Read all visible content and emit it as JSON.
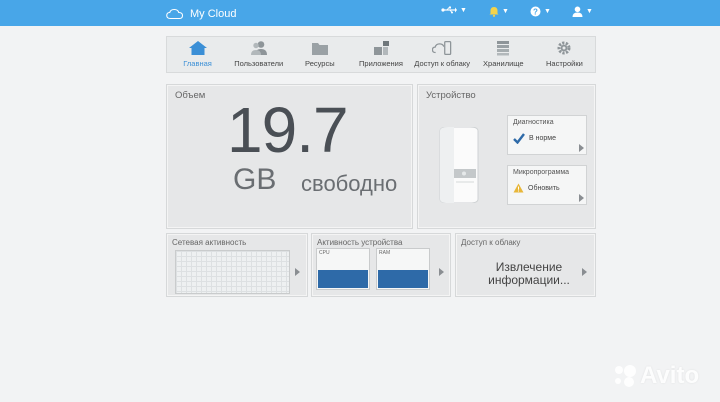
{
  "topbar": {
    "brand": "My Cloud",
    "icons": [
      "usb-icon",
      "bell-icon",
      "help-icon",
      "user-icon"
    ],
    "accent_color": "#48a6e8"
  },
  "nav": {
    "items": [
      {
        "label": "Главная",
        "icon": "home-icon",
        "active": true
      },
      {
        "label": "Пользователи",
        "icon": "users-icon"
      },
      {
        "label": "Ресурсы",
        "icon": "folder-icon"
      },
      {
        "label": "Приложения",
        "icon": "apps-icon"
      },
      {
        "label": "Доступ к облаку",
        "icon": "cloud-phone-icon"
      },
      {
        "label": "Хранилище",
        "icon": "storage-icon"
      },
      {
        "label": "Настройки",
        "icon": "gear-icon"
      }
    ]
  },
  "capacity": {
    "title": "Объем",
    "value": "19.7",
    "unit": "GB",
    "status": "свободно"
  },
  "device": {
    "title": "Устройство",
    "diagnostics": {
      "title": "Диагностика",
      "status": "В норме"
    },
    "firmware": {
      "title": "Микропрограмма",
      "status": "Обновить"
    }
  },
  "network": {
    "title": "Сетевая активность"
  },
  "device_activity": {
    "title": "Активность устройства",
    "cpu_label": "CPU",
    "ram_label": "RAM"
  },
  "cloud_access": {
    "title": "Доступ к облаку",
    "status_line1": "Извлечение",
    "status_line2": "информации..."
  },
  "watermark": {
    "text": "Avito"
  }
}
